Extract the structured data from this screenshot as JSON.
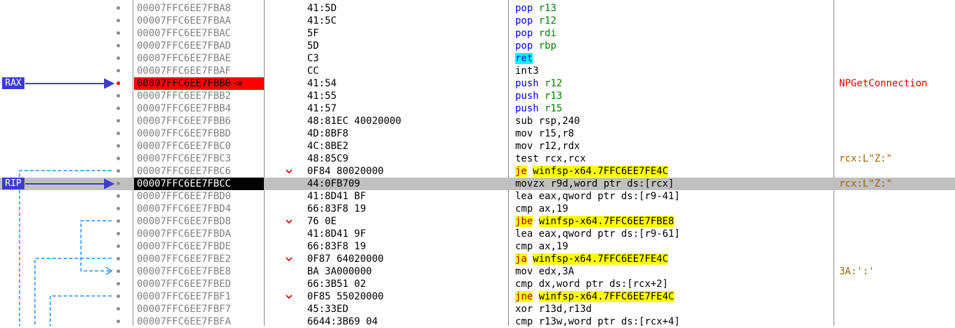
{
  "register_labels": {
    "rax": "RAX",
    "rip": "RIP"
  },
  "colors": {
    "breakpoint": "#ff0000",
    "current_row": "#c0c0c0",
    "label_bg": "#3c3cd2",
    "jump_line": "#1e90ff"
  },
  "rows": [
    {
      "addr": "00007FFC6EE7FBA8",
      "bytes": "41:5D",
      "mn": "pop",
      "ops": "r13",
      "kind": "pop",
      "comment": ""
    },
    {
      "addr": "00007FFC6EE7FBAA",
      "bytes": "41:5C",
      "mn": "pop",
      "ops": "r12",
      "kind": "pop",
      "comment": ""
    },
    {
      "addr": "00007FFC6EE7FBAC",
      "bytes": "5F",
      "mn": "pop",
      "ops": "rdi",
      "kind": "pop",
      "comment": ""
    },
    {
      "addr": "00007FFC6EE7FBAD",
      "bytes": "5D",
      "mn": "pop",
      "ops": "rbp",
      "kind": "pop",
      "comment": ""
    },
    {
      "addr": "00007FFC6EE7FBAE",
      "bytes": "C3",
      "mn": "ret",
      "ops": "",
      "kind": "ret",
      "comment": ""
    },
    {
      "addr": "00007FFC6EE7FBAF",
      "bytes": "CC",
      "mn": "int3",
      "ops": "",
      "kind": "plain",
      "comment": ""
    },
    {
      "addr": "00007FFC6EE7FBB0",
      "tag": "<W",
      "bytes": "41:54",
      "mn": "push",
      "ops": "r12",
      "kind": "push",
      "comment": "NPGetConnection"
    },
    {
      "addr": "00007FFC6EE7FBB2",
      "bytes": "41:55",
      "mn": "push",
      "ops": "r13",
      "kind": "push",
      "comment": ""
    },
    {
      "addr": "00007FFC6EE7FBB4",
      "bytes": "41:57",
      "mn": "push",
      "ops": "r15",
      "kind": "push",
      "comment": ""
    },
    {
      "addr": "00007FFC6EE7FBB6",
      "bytes": "48:81EC 40020000",
      "mn": "sub",
      "ops": "rsp,240",
      "kind": "plain",
      "comment": ""
    },
    {
      "addr": "00007FFC6EE7FBBD",
      "bytes": "4D:8BF8",
      "mn": "mov",
      "ops": "r15,r8",
      "kind": "plain",
      "comment": ""
    },
    {
      "addr": "00007FFC6EE7FBC0",
      "bytes": "4C:8BE2",
      "mn": "mov",
      "ops": "r12,rdx",
      "kind": "plain",
      "comment": ""
    },
    {
      "addr": "00007FFC6EE7FBC3",
      "bytes": "48:85C9",
      "mn": "test",
      "ops": "rcx,rcx",
      "kind": "plain",
      "comment": "rcx:L\"Z:\""
    },
    {
      "addr": "00007FFC6EE7FBC6",
      "bytes": "0F84 80020000",
      "mn": "je",
      "ops": "winfsp-x64.7FFC6EE7FE4C",
      "kind": "jcc",
      "comment": ""
    },
    {
      "addr": "00007FFC6EE7FBCC",
      "bytes": "44:0FB709",
      "mn": "movzx",
      "ops": "r9d,word ptr ds:[rcx]",
      "kind": "plain",
      "comment": "rcx:L\"Z:\""
    },
    {
      "addr": "00007FFC6EE7FBD0",
      "bytes": "41:8D41 BF",
      "mn": "lea",
      "ops": "eax,qword ptr ds:[r9-41]",
      "kind": "plain",
      "comment": ""
    },
    {
      "addr": "00007FFC6EE7FBD4",
      "bytes": "66:83F8 19",
      "mn": "cmp",
      "ops": "ax,19",
      "kind": "plain",
      "comment": ""
    },
    {
      "addr": "00007FFC6EE7FBD8",
      "bytes": "76 0E",
      "mn": "jbe",
      "ops": "winfsp-x64.7FFC6EE7FBE8",
      "kind": "jcc",
      "comment": ""
    },
    {
      "addr": "00007FFC6EE7FBDA",
      "bytes": "41:8D41 9F",
      "mn": "lea",
      "ops": "eax,qword ptr ds:[r9-61]",
      "kind": "plain",
      "comment": ""
    },
    {
      "addr": "00007FFC6EE7FBDE",
      "bytes": "66:83F8 19",
      "mn": "cmp",
      "ops": "ax,19",
      "kind": "plain",
      "comment": ""
    },
    {
      "addr": "00007FFC6EE7FBE2",
      "bytes": "0F87 64020000",
      "mn": "ja",
      "ops": "winfsp-x64.7FFC6EE7FE4C",
      "kind": "jcc",
      "comment": ""
    },
    {
      "addr": "00007FFC6EE7FBE8",
      "bytes": "BA 3A000000",
      "mn": "mov",
      "ops": "edx,3A",
      "kind": "plain",
      "comment": "3A:':'"
    },
    {
      "addr": "00007FFC6EE7FBED",
      "bytes": "66:3B51 02",
      "mn": "cmp",
      "ops": "dx,word ptr ds:[rcx+2]",
      "kind": "plain",
      "comment": ""
    },
    {
      "addr": "00007FFC6EE7FBF1",
      "bytes": "0F85 55020000",
      "mn": "jne",
      "ops": "winfsp-x64.7FFC6EE7FE4C",
      "kind": "jcc",
      "comment": ""
    },
    {
      "addr": "00007FFC6EE7FBF7",
      "bytes": "45:33ED",
      "mn": "xor",
      "ops": "r13d,r13d",
      "kind": "plain",
      "comment": ""
    },
    {
      "addr": "00007FFC6EE7FBFA",
      "bytes": "6644:3B69 04",
      "mn": "cmp",
      "ops": "r13w,word ptr ds:[rcx+4]",
      "kind": "plain",
      "comment": ""
    }
  ]
}
